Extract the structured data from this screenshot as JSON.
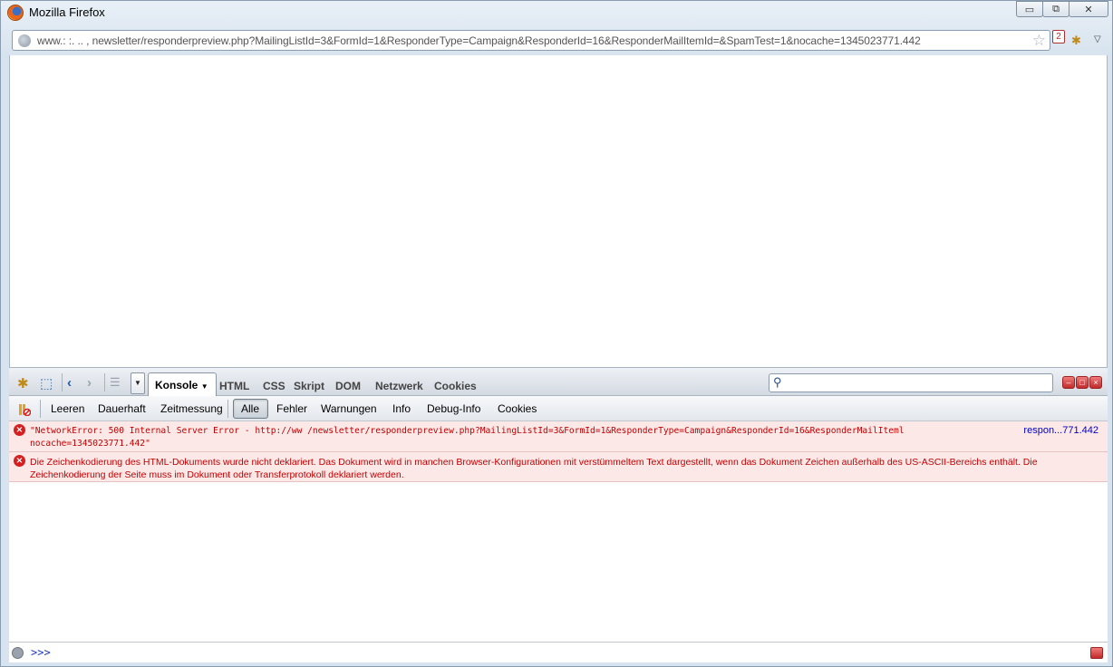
{
  "window": {
    "title": "Mozilla Firefox",
    "min": "▭",
    "max": "⧉",
    "close": "✕"
  },
  "address": {
    "prefix": "www.:    :.          ..      ,",
    "path": "newsletter/responderpreview.php?MailingListId=3&FormId=1&ResponderType=Campaign&ResponderId=16&ResponderMailItemId=&SpamTest=1&nocache=1345023771.442",
    "badge": "2"
  },
  "firebug": {
    "tabs": {
      "konsole": "Konsole",
      "html": "HTML",
      "css": "CSS",
      "skript": "Skript",
      "dom": "DOM",
      "netzwerk": "Netzwerk",
      "cookies": "Cookies"
    },
    "search_placeholder": ""
  },
  "console_bar": {
    "leeren": "Leeren",
    "dauerhaft": "Dauerhaft",
    "zeitmessung": "Zeitmessung",
    "alle": "Alle",
    "fehler": "Fehler",
    "warnungen": "Warnungen",
    "info": "Info",
    "debug": "Debug-Info",
    "cookies": "Cookies"
  },
  "messages": {
    "error1_line1": "\"NetworkError: 500 Internal Server Error - http://ww                      /newsletter/responderpreview.php?MailingListId=3&FormId=1&ResponderType=Campaign&ResponderId=16&ResponderMailIteml",
    "error1_line2": "nocache=1345023771.442\"",
    "error1_source": "respon...771.442",
    "error2": "Die Zeichenkodierung des HTML-Dokuments wurde nicht deklariert. Das Dokument wird in manchen Browser-Konfigurationen mit verstümmeltem Text dargestellt, wenn das Dokument Zeichen außerhalb des US-ASCII-Bereichs enthält. Die Zeichenkodierung der Seite muss im Dokument oder Transferprotokoll deklariert werden."
  },
  "cmdline": {
    "prompt": ">>>"
  }
}
